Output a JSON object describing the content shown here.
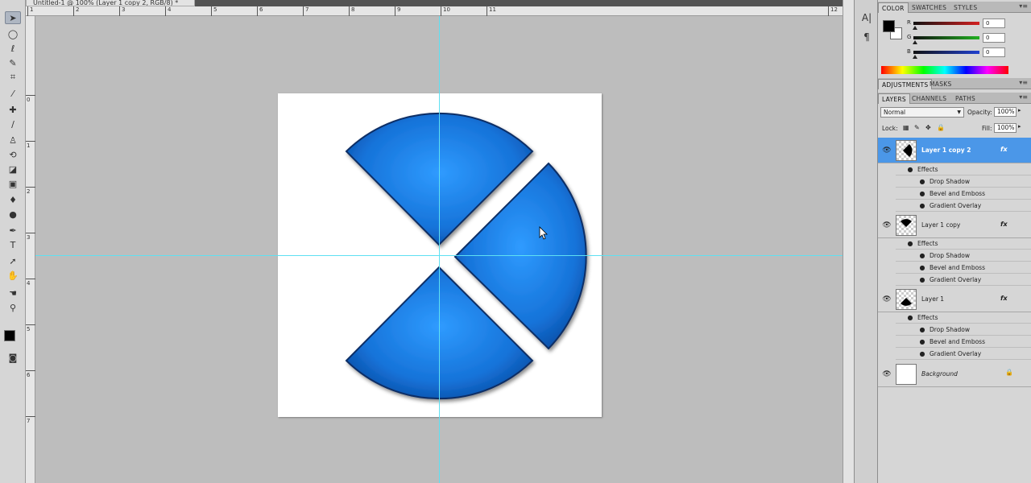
{
  "document": {
    "tab_title": "Untitled-1 @ 100% (Layer 1 copy 2, RGB/8) *",
    "ruler_top": [
      "1",
      "2",
      "3",
      "4",
      "5",
      "6",
      "7",
      "8",
      "9",
      "10",
      "11",
      "12"
    ],
    "ruler_left": [
      "0",
      "1",
      "2",
      "3",
      "4",
      "5",
      "6",
      "7"
    ]
  },
  "tools": [
    "move-tool",
    "marquee-tool",
    "lasso-tool",
    "quick-select-tool",
    "crop-tool",
    "eyedropper-tool",
    "healing-tool",
    "brush-tool",
    "stamp-tool",
    "history-brush-tool",
    "eraser-tool",
    "gradient-tool",
    "blur-tool",
    "dodge-tool",
    "pen-tool",
    "type-tool",
    "path-select-tool",
    "shape-tool",
    "hand-tool",
    "zoom-tool"
  ],
  "mini_dock": {
    "char_label": "A|",
    "para_label": "¶"
  },
  "color_panel": {
    "tabs": [
      "COLOR",
      "SWATCHES",
      "STYLES"
    ],
    "channels": [
      {
        "label": "R",
        "value": "0",
        "color": "#d42020"
      },
      {
        "label": "G",
        "value": "0",
        "color": "#20b020"
      },
      {
        "label": "B",
        "value": "0",
        "color": "#2040d0"
      }
    ]
  },
  "adjustments_panel": {
    "tabs": [
      "ADJUSTMENTS",
      "MASKS"
    ]
  },
  "layers_panel": {
    "tabs": [
      "LAYERS",
      "CHANNELS",
      "PATHS"
    ],
    "blend_mode": "Normal",
    "opacity_label": "Opacity:",
    "opacity_value": "100%",
    "lock_label": "Lock:",
    "fill_label": "Fill:",
    "fill_value": "100%",
    "layers": [
      {
        "name": "Layer 1 copy 2",
        "selected": true,
        "effects_label": "Effects",
        "effects": [
          "Drop Shadow",
          "Bevel and Emboss",
          "Gradient Overlay"
        ],
        "fx": "fx"
      },
      {
        "name": "Layer 1 copy",
        "selected": false,
        "effects_label": "Effects",
        "effects": [
          "Drop Shadow",
          "Bevel and Emboss",
          "Gradient Overlay"
        ],
        "fx": "fx"
      },
      {
        "name": "Layer 1",
        "selected": false,
        "effects_label": "Effects",
        "effects": [
          "Drop Shadow",
          "Bevel and Emboss",
          "Gradient Overlay"
        ],
        "fx": "fx"
      },
      {
        "name": "Background",
        "selected": false
      }
    ]
  },
  "colors": {
    "selection": "#4b97e8",
    "guide": "#5ee0f2",
    "wedge_light": "#2f9bff",
    "wedge_dark": "#0a4fa8"
  }
}
